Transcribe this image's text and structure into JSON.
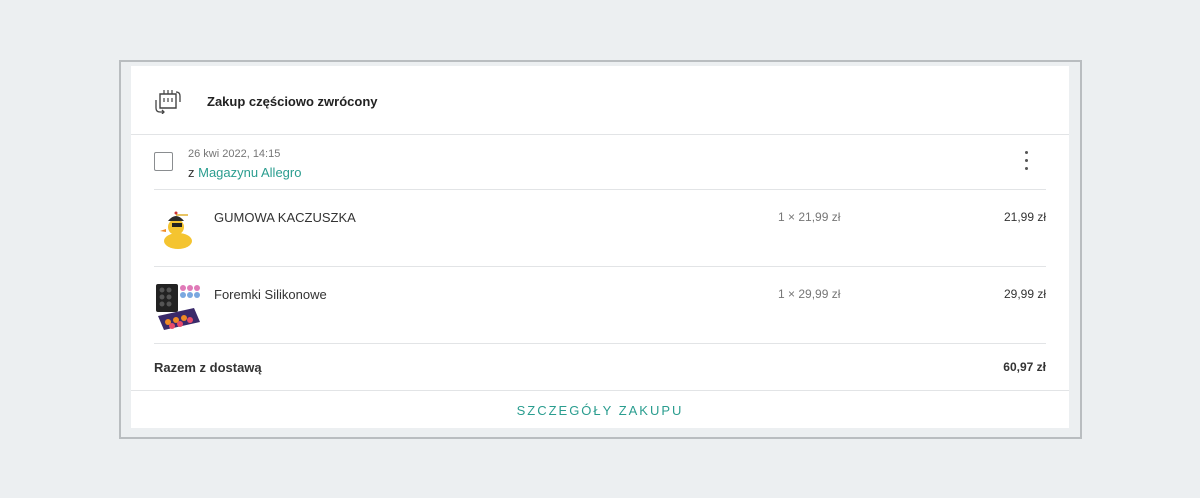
{
  "order": {
    "status_title": "Zakup częściowo zwrócony",
    "status_icon": "return-box-icon",
    "date": "26 kwi 2022, 14:15",
    "source_prefix": "z",
    "source_link": "Magazynu Allegro",
    "menu_icon": "kebab-menu-icon"
  },
  "items": [
    {
      "name": "GUMOWA KACZUSZKA",
      "qty": "1 × 21,99 zł",
      "price": "21,99 zł",
      "thumb_icon": "rubber-duck-image"
    },
    {
      "name": "Foremki Silikonowe",
      "qty": "1 × 29,99 zł",
      "price": "29,99 zł",
      "thumb_icon": "silicone-molds-image"
    }
  ],
  "summary": {
    "label": "Razem z dostawą",
    "amount": "60,97 zł"
  },
  "footer": {
    "details_label": "SZCZEGÓŁY ZAKUPU"
  },
  "colors": {
    "accent": "#2a9d8f",
    "background": "#eceff1"
  }
}
